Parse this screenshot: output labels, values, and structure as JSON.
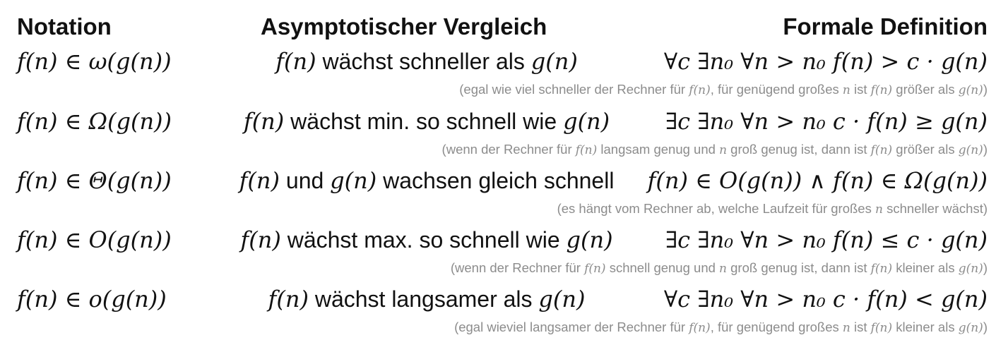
{
  "headers": {
    "notation": "Notation",
    "comparison": "Asymptotischer Vergleich",
    "definition": "Formale Definition"
  },
  "rows": [
    {
      "notation": "f(n) ∈ ω(g(n))",
      "comparison": "f(n) wächst schneller als g(n)",
      "definition": "∀c ∃n₀ ∀n > n₀ f(n) > c · g(n)",
      "note": "(egal wie viel schneller der Rechner für f(n), für genügend großes n ist f(n) größer als g(n))"
    },
    {
      "notation": "f(n) ∈ Ω(g(n))",
      "comparison": "f(n) wächst min. so schnell wie g(n)",
      "definition": "∃c ∃n₀ ∀n > n₀ c · f(n) ≥ g(n)",
      "note": "(wenn der Rechner für f(n) langsam genug und n groß genug ist, dann ist f(n) größer als g(n))"
    },
    {
      "notation": "f(n) ∈ Θ(g(n))",
      "comparison": "f(n) und g(n) wachsen gleich schnell",
      "definition": "f(n) ∈ O(g(n)) ∧ f(n) ∈ Ω(g(n))",
      "note": "(es hängt vom Rechner ab, welche Laufzeit für großes n schneller wächst)"
    },
    {
      "notation": "f(n) ∈ O(g(n))",
      "comparison": "f(n) wächst max. so schnell wie g(n)",
      "definition": "∃c ∃n₀ ∀n > n₀ f(n) ≤ c · g(n)",
      "note": "(wenn der Rechner für f(n) schnell genug und n groß genug ist, dann ist f(n) kleiner als g(n))"
    },
    {
      "notation": "f(n) ∈ o(g(n))",
      "comparison": "f(n) wächst langsamer als g(n)",
      "definition": "∀c ∃n₀ ∀n > n₀ c · f(n) < g(n)",
      "note": "(egal wieviel langsamer der Rechner für f(n), für genügend großes n ist f(n) kleiner als g(n))"
    }
  ]
}
